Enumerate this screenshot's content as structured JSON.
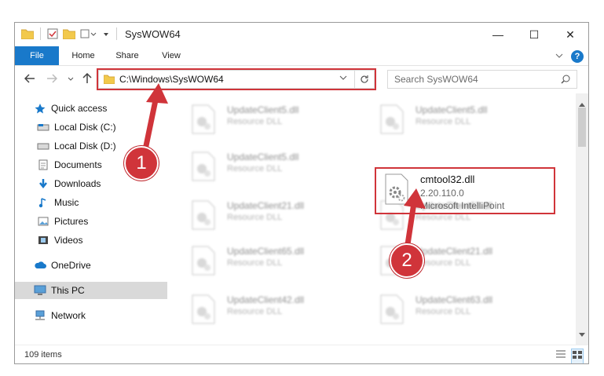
{
  "window": {
    "title": "SysWOW64",
    "controls": {
      "minimize": "—",
      "maximize": "☐",
      "close": "✕"
    }
  },
  "ribbon": {
    "tabs": [
      "File",
      "Home",
      "Share",
      "View"
    ],
    "help": "?"
  },
  "address": {
    "path": "C:\\Windows\\SysWOW64",
    "search_placeholder": "Search SysWOW64"
  },
  "sidebar": {
    "items": [
      {
        "label": "Quick access"
      },
      {
        "label": "Local Disk (C:)"
      },
      {
        "label": "Local Disk (D:)"
      },
      {
        "label": "Documents"
      },
      {
        "label": "Downloads"
      },
      {
        "label": "Music"
      },
      {
        "label": "Pictures"
      },
      {
        "label": "Videos"
      },
      {
        "label": "OneDrive"
      },
      {
        "label": "This PC"
      },
      {
        "label": "Network"
      }
    ]
  },
  "files": [
    {
      "name": "UpdateClient5.dll",
      "type": "Resource DLL"
    },
    {
      "name": "UpdateClient5.dll",
      "type": "Resource DLL"
    },
    {
      "name": "UpdateClient5.dll",
      "type": "Resource DLL"
    },
    {
      "name": "UpdateClient21.dll",
      "type": "Resource DLL"
    },
    {
      "name": "UpdateClient63.dll",
      "type": "Resource DLL"
    },
    {
      "name": "UpdateClient65.dll",
      "type": "Resource DLL"
    },
    {
      "name": "UpdateClient21.dll",
      "type": "Resource DLL"
    },
    {
      "name": "UpdateClient42.dll",
      "type": "Resource DLL"
    },
    {
      "name": "UpdateClient63.dll",
      "type": "Resource DLL"
    }
  ],
  "highlighted_file": {
    "name": "cmtool32.dll",
    "version": "2.20.110.0",
    "description": "Microsoft IntelliPoint"
  },
  "status": {
    "items": "109 items"
  },
  "badges": {
    "step1": "1",
    "step2": "2"
  },
  "colors": {
    "accent": "#1979ca",
    "highlight": "#d0343a"
  }
}
